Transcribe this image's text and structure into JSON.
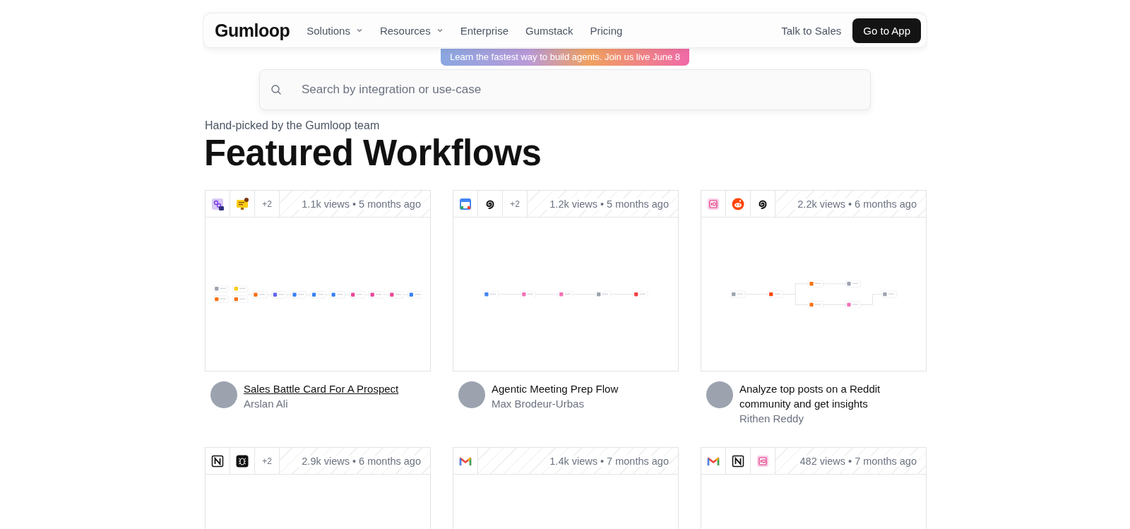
{
  "nav": {
    "logo": "Gumloop",
    "links": [
      {
        "label": "Solutions",
        "dropdown": true
      },
      {
        "label": "Resources",
        "dropdown": true
      },
      {
        "label": "Enterprise",
        "dropdown": false
      },
      {
        "label": "Gumstack",
        "dropdown": false
      },
      {
        "label": "Pricing",
        "dropdown": false
      }
    ],
    "talk_to_sales": "Talk to Sales",
    "go_to_app": "Go to App"
  },
  "banner": "Learn the fastest way to build agents. Join us live June 8",
  "search": {
    "placeholder": "Search by integration or use-case"
  },
  "section": {
    "eyebrow": "Hand-picked by the Gumloop team",
    "heading": "Featured Workflows"
  },
  "cards": [
    {
      "icons": [
        {
          "kind": "puzzle"
        },
        {
          "kind": "monitor"
        }
      ],
      "more": "+2",
      "stats": "1.1k views • 5 months ago",
      "preview": {
        "kind": "picture"
      },
      "title": "Sales Battle Card For A Prospect",
      "author": "Arslan Ali",
      "hovered": true
    },
    {
      "icons": [
        {
          "kind": "calendar"
        },
        {
          "kind": "spiral"
        }
      ],
      "more": "+2",
      "stats": "1.2k views • 5 months ago",
      "preview": {
        "kind": "picture"
      },
      "title": "Agentic Meeting Prep Flow",
      "author": "Max Brodeur-Urbas",
      "hovered": false
    },
    {
      "icons": [
        {
          "kind": "chip"
        },
        {
          "kind": "alien"
        },
        {
          "kind": "spiral"
        }
      ],
      "stats": "2.2k views • 6 months ago",
      "preview": {
        "kind": "picture"
      },
      "title": "Analyze top posts on a Reddit community and get insights",
      "author": "Rithen Reddy",
      "hovered": false
    },
    {
      "icons": [
        {
          "kind": "letter"
        },
        {
          "kind": "bug"
        }
      ],
      "more": "+2",
      "stats": "2.9k views • 6 months ago"
    },
    {
      "icons": [
        {
          "kind": "mail"
        }
      ],
      "stats": "1.4k views • 7 months ago"
    },
    {
      "icons": [
        {
          "kind": "mail"
        },
        {
          "kind": "letter"
        },
        {
          "kind": "chip"
        }
      ],
      "stats": "482 views • 7 months ago"
    }
  ]
}
